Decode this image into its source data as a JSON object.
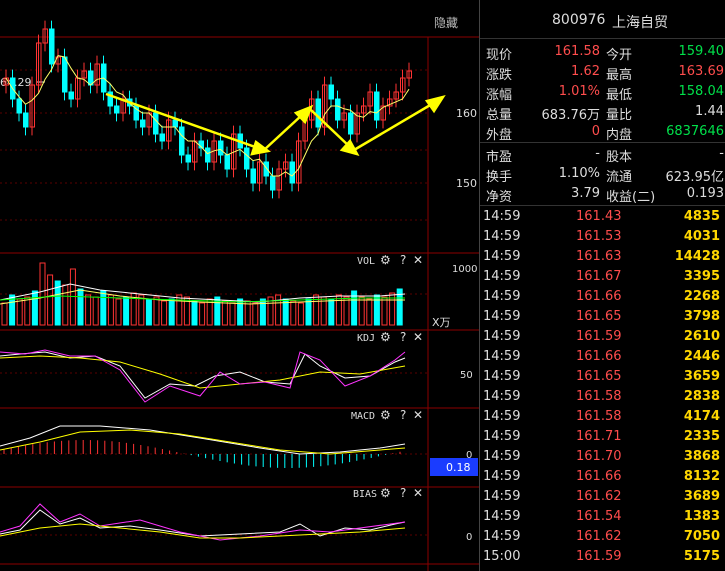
{
  "toolbar": {
    "hide_label": "隐藏"
  },
  "stock": {
    "code": "800976",
    "name": "上海自贸"
  },
  "quote": {
    "rows": [
      {
        "l1": "现价",
        "v1": "161.58",
        "c1": "red",
        "l2": "今开",
        "v2": "159.40",
        "c2": "grn"
      },
      {
        "l1": "涨跌",
        "v1": "1.62",
        "c1": "red",
        "l2": "最高",
        "v2": "163.69",
        "c2": "red"
      },
      {
        "l1": "涨幅",
        "v1": "1.01%",
        "c1": "red",
        "l2": "最低",
        "v2": "158.04",
        "c2": "grn"
      },
      {
        "l1": "总量",
        "v1": "683.76万",
        "c1": "wht",
        "l2": "量比",
        "v2": "1.44",
        "c2": "wht"
      },
      {
        "l1": "外盘",
        "v1": "0",
        "c1": "red",
        "l2": "内盘",
        "v2": "6837646",
        "c2": "grn"
      }
    ],
    "rows2": [
      {
        "l1": "市盈",
        "v1": "-",
        "c1": "wht",
        "l2": "股本",
        "v2": "-",
        "c2": "wht"
      },
      {
        "l1": "换手",
        "v1": "1.10%",
        "c1": "wht",
        "l2": "流通",
        "v2": "623.95亿",
        "c2": "wht"
      },
      {
        "l1": "净资",
        "v1": "3.79",
        "c1": "wht",
        "l2": "收益(二)",
        "v2": "0.193",
        "c2": "wht"
      }
    ]
  },
  "ticks": [
    {
      "t": "14:59",
      "p": "161.43",
      "v": "4835"
    },
    {
      "t": "14:59",
      "p": "161.53",
      "v": "4031"
    },
    {
      "t": "14:59",
      "p": "161.63",
      "v": "14428"
    },
    {
      "t": "14:59",
      "p": "161.67",
      "v": "3395"
    },
    {
      "t": "14:59",
      "p": "161.66",
      "v": "2268"
    },
    {
      "t": "14:59",
      "p": "161.65",
      "v": "3798"
    },
    {
      "t": "14:59",
      "p": "161.59",
      "v": "2610"
    },
    {
      "t": "14:59",
      "p": "161.66",
      "v": "2446"
    },
    {
      "t": "14:59",
      "p": "161.65",
      "v": "3659"
    },
    {
      "t": "14:59",
      "p": "161.58",
      "v": "2838"
    },
    {
      "t": "14:59",
      "p": "161.58",
      "v": "4174"
    },
    {
      "t": "14:59",
      "p": "161.71",
      "v": "2335"
    },
    {
      "t": "14:59",
      "p": "161.70",
      "v": "3868"
    },
    {
      "t": "14:59",
      "p": "161.66",
      "v": "8132"
    },
    {
      "t": "14:59",
      "p": "161.62",
      "v": "3689"
    },
    {
      "t": "14:59",
      "p": "161.54",
      "v": "1383"
    },
    {
      "t": "14:59",
      "p": "161.62",
      "v": "7050"
    },
    {
      "t": "15:00",
      "p": "161.59",
      "v": "5175"
    }
  ],
  "chart": {
    "price_axis": [
      "160",
      "150"
    ],
    "high_marker": "64.29",
    "vol_title": "VOL",
    "vol_axis": "1000",
    "vol_unit": "X万",
    "kdj_title": "KDJ",
    "kdj_axis": "50",
    "macd_title": "MACD",
    "macd_axis": "0",
    "macd_value": "0.18",
    "bias_title": "BIAS",
    "bias_axis": "0",
    "icons": {
      "gear": "⚙",
      "help": "?",
      "close": "✕"
    }
  },
  "colors": {
    "up": "#ff3333",
    "down": "#00ffff",
    "arrow": "#ffff00",
    "ma": "#ffff66"
  }
}
